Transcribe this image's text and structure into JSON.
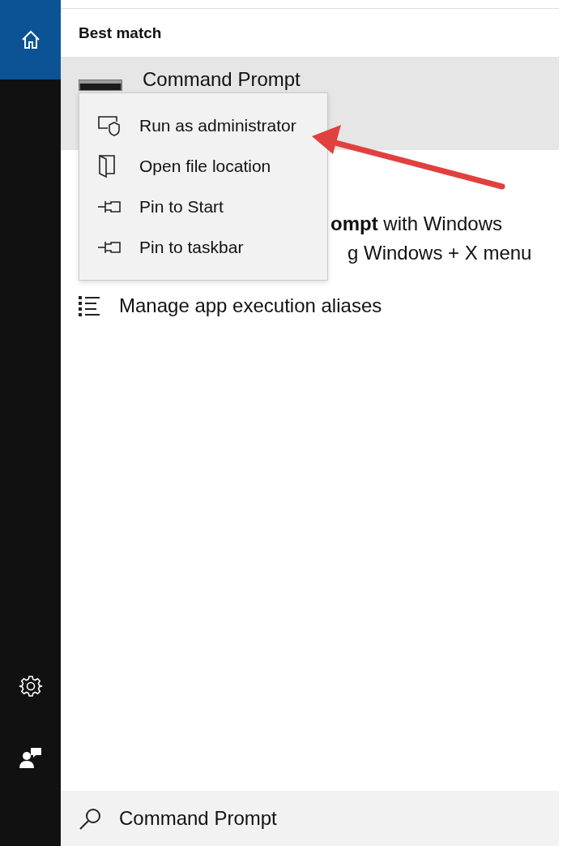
{
  "sidebar": {
    "items": [
      {
        "kind": "home",
        "selected": true
      },
      {
        "kind": "settings",
        "selected": false
      },
      {
        "kind": "feedback",
        "selected": false
      }
    ]
  },
  "results": {
    "section_title": "Best match",
    "best_match": {
      "title": "Command Prompt",
      "selected": true
    },
    "description_lines": [
      "**ompt** with Windows",
      "g Windows + X menu"
    ],
    "actions": [
      {
        "label": "Manage app execution aliases"
      }
    ]
  },
  "context_menu": {
    "items": [
      {
        "kind": "admin",
        "label": "Run as administrator"
      },
      {
        "kind": "folder",
        "label": "Open file location"
      },
      {
        "kind": "pin",
        "label": "Pin to Start"
      },
      {
        "kind": "pin",
        "label": "Pin to taskbar"
      }
    ]
  },
  "search": {
    "value": "Command Prompt"
  }
}
